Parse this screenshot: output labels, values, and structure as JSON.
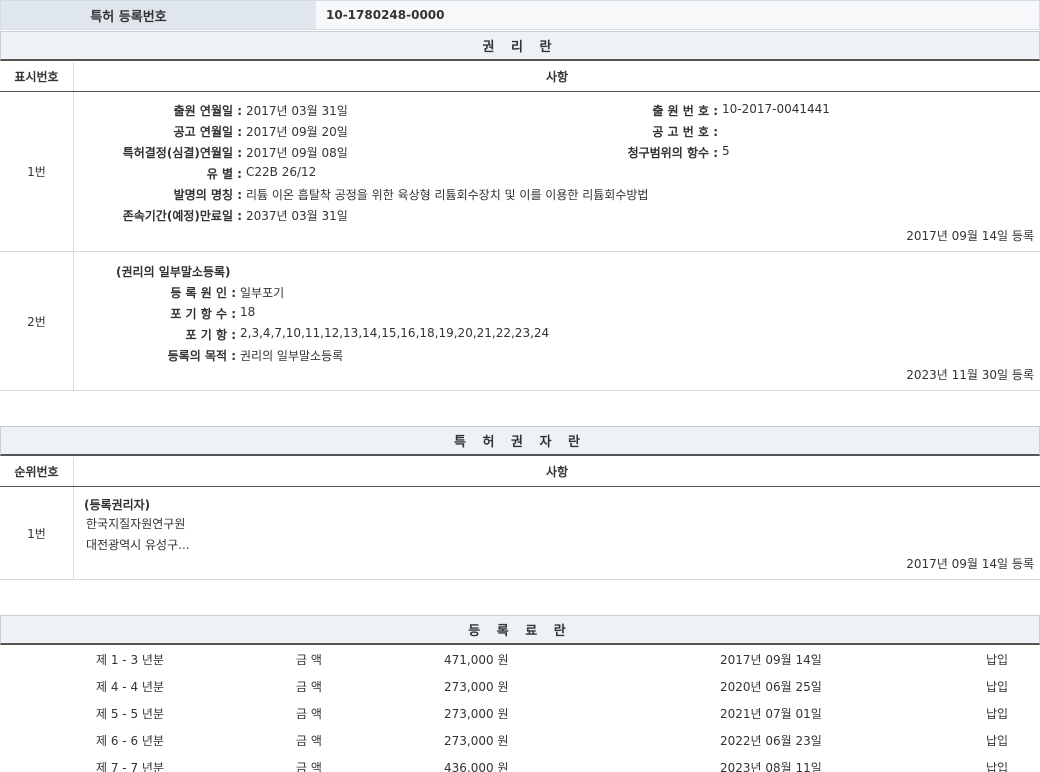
{
  "registration": {
    "label": "특허 등록번호",
    "value": "10-1780248-0000"
  },
  "rights": {
    "title": "권 리 란",
    "col_num": "표시번호",
    "col_item": "사항",
    "row1": {
      "num": "1번",
      "filing_date_label": "출원 연월일 :",
      "filing_date": "2017년 03월 31일",
      "filing_no_label": "출 원 번 호 :",
      "filing_no": "10-2017-0041441",
      "pub_date_label": "공고 연월일 :",
      "pub_date": "2017년 09월 20일",
      "pub_no_label": "공 고 번 호 :",
      "pub_no": "",
      "decision_label": "특허결정(심결)연월일 :",
      "decision_date": "2017년 09월 08일",
      "claims_label": "청구범위의 항수 :",
      "claims": "5",
      "class_label": "유 별 :",
      "class": "C22B 26/12",
      "title_label": "발명의 명칭 :",
      "invention_title": "리튬 이온 흡탈착 공정을 위한 육상형 리튬회수장치 및 이를 이용한 리튬회수방법",
      "expiry_label": "존속기간(예정)만료일 :",
      "expiry": "2037년 03월 31일",
      "registered": "2017년 09월 14일 등록"
    },
    "row2": {
      "num": "2번",
      "heading": "(권리의 일부말소등록)",
      "cause_label": "등 록 원 인 :",
      "cause": "일부포기",
      "count_label": "포 기 항 수 :",
      "count": "18",
      "items_label": "포 기 항 :",
      "items": "2,3,4,7,10,11,12,13,14,15,16,18,19,20,21,22,23,24",
      "purpose_label": "등록의 목적 :",
      "purpose": "권리의 일부말소등록",
      "registered": "2023년 11월 30일 등록"
    }
  },
  "holders": {
    "title": "특 허 권 자 란",
    "col_num": "순위번호",
    "col_item": "사항",
    "row1": {
      "num": "1번",
      "heading": "(등록권리자)",
      "name": "한국지질자원연구원",
      "address": "대전광역시 유성구...",
      "registered": "2017년 09월 14일 등록"
    }
  },
  "fees": {
    "title": "등 록 료 란",
    "rows": [
      {
        "period": "제 1 - 3 년분",
        "amount_label": "금 액",
        "amount": "471,000 원",
        "date": "2017년 09월 14일",
        "status": "납입"
      },
      {
        "period": "제 4 - 4 년분",
        "amount_label": "금 액",
        "amount": "273,000 원",
        "date": "2020년 06월 25일",
        "status": "납입"
      },
      {
        "period": "제 5 - 5 년분",
        "amount_label": "금 액",
        "amount": "273,000 원",
        "date": "2021년 07월 01일",
        "status": "납입"
      },
      {
        "period": "제 6 - 6 년분",
        "amount_label": "금 액",
        "amount": "273,000 원",
        "date": "2022년 06월 23일",
        "status": "납입"
      },
      {
        "period": "제 7 - 7 년분",
        "amount_label": "금 액",
        "amount": "436,000 원",
        "date": "2023년 08월 11일",
        "status": "납입"
      }
    ]
  }
}
